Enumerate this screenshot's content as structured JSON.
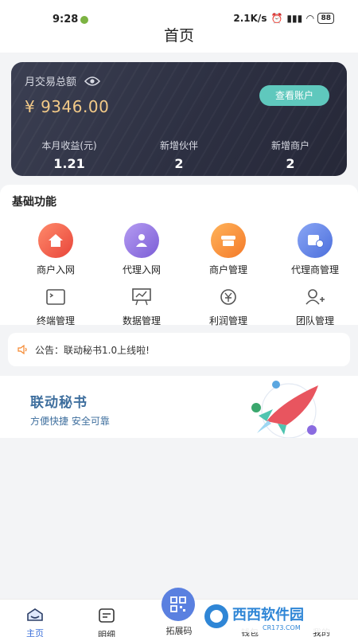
{
  "status_bar": {
    "time": "9:28",
    "network": "2.1K/s",
    "battery": "88"
  },
  "header": {
    "title": "首页"
  },
  "card": {
    "label": "月交易总额",
    "amount": "¥ 9346.00",
    "button": "查看账户",
    "stats": [
      {
        "label": "本月收益(元)",
        "value": "1.21"
      },
      {
        "label": "新增伙伴",
        "value": "2"
      },
      {
        "label": "新增商户",
        "value": "2"
      }
    ]
  },
  "functions": {
    "title": "基础功能",
    "primary": [
      {
        "label": "商户入网",
        "icon": "home-icon",
        "color": "#f0573f"
      },
      {
        "label": "代理入网",
        "icon": "agent-icon",
        "color": "#8a6be0"
      },
      {
        "label": "商户管理",
        "icon": "shop-icon",
        "color": "#f5872e"
      },
      {
        "label": "代理商管理",
        "icon": "agent-badge-icon",
        "color": "#5a80e0"
      }
    ],
    "secondary": [
      {
        "label": "终端管理",
        "icon": "terminal-icon"
      },
      {
        "label": "数据管理",
        "icon": "chart-board-icon"
      },
      {
        "label": "利润管理",
        "icon": "yuan-icon"
      },
      {
        "label": "团队管理",
        "icon": "team-icon"
      }
    ]
  },
  "notice": {
    "text": "公告：联动秘书1.0上线啦!"
  },
  "banner": {
    "title": "联动秘书",
    "subtitle": "方便快捷  安全可靠"
  },
  "tabbar": {
    "tabs": [
      "主页",
      "明细",
      "拓展码",
      "钱包",
      "我的"
    ]
  },
  "watermark": {
    "text": "西西软件园",
    "sub": "CR173.COM"
  }
}
